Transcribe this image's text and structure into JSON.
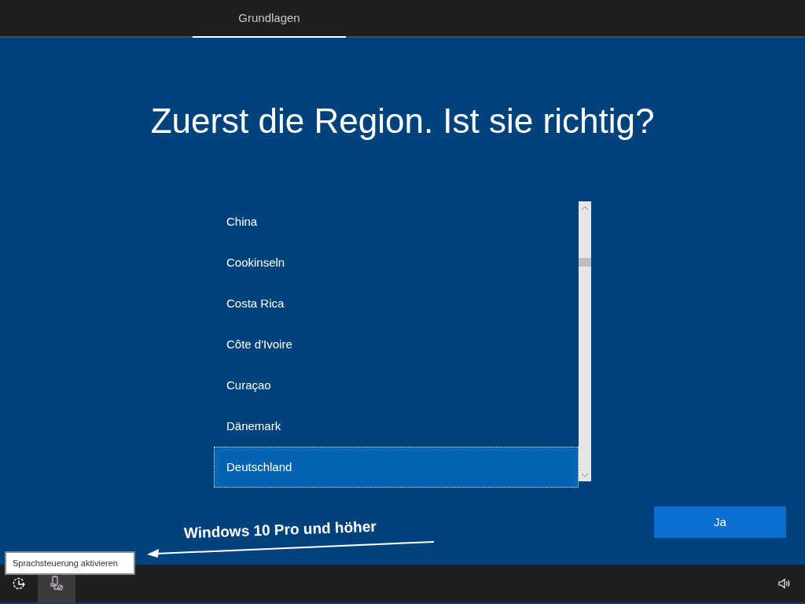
{
  "tabs": [
    {
      "label": "Grundlagen",
      "selected": true
    }
  ],
  "heading": "Zuerst die Region. Ist sie richtig?",
  "regions": [
    {
      "label": "China",
      "selected": false
    },
    {
      "label": "Cookinseln",
      "selected": false
    },
    {
      "label": "Costa Rica",
      "selected": false
    },
    {
      "label": "Côte d'Ivoire",
      "selected": false
    },
    {
      "label": "Curaçao",
      "selected": false
    },
    {
      "label": "Dänemark",
      "selected": false
    },
    {
      "label": "Deutschland",
      "selected": true
    }
  ],
  "confirm_button": "Ja",
  "annotation": "Windows 10 Pro und höher",
  "tooltip": "Sprachsteuerung aktivieren"
}
